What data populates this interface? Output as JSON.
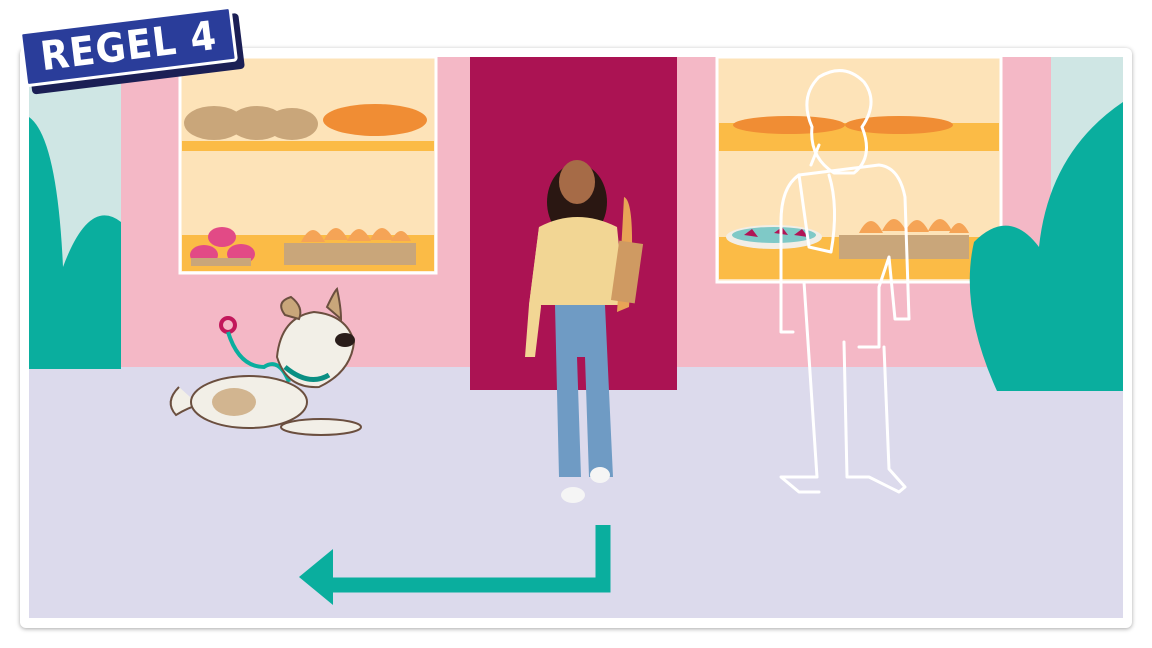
{
  "badge": {
    "label": "REGEL 4"
  },
  "colors": {
    "wall": "#f4b8c6",
    "door": "#b01556",
    "pavement": "#dcdaec",
    "window": "#fde3b8",
    "shelf": "#fbbb46",
    "bush": "#0aae9e",
    "arrow": "#0aae9e",
    "badge": "#2a3d9a"
  },
  "icons": [
    "bread-loaves",
    "baguettes",
    "cupcakes",
    "croissants",
    "tart",
    "dog-illustration",
    "leash-ring",
    "girl-photo",
    "baguette",
    "person-outline",
    "direction-arrow",
    "bush"
  ]
}
